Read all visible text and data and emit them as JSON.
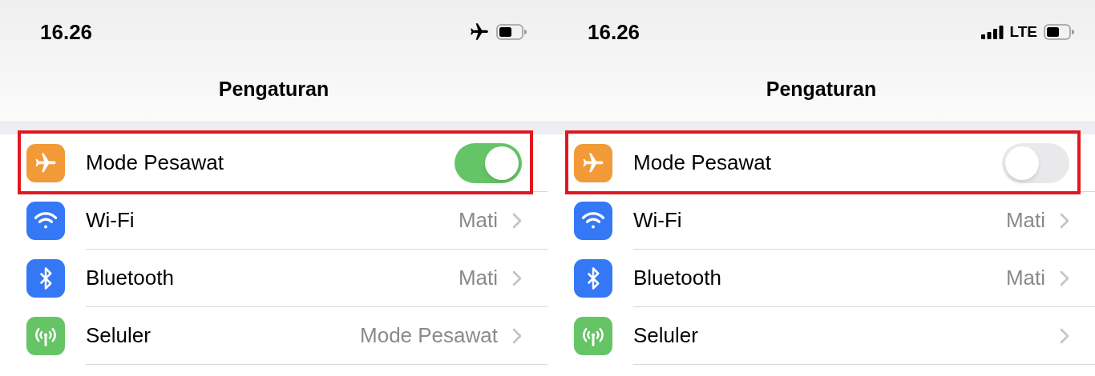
{
  "panels": [
    {
      "status_bar": {
        "time": "16.26",
        "icons": [
          {
            "kind": "airplane"
          },
          {
            "kind": "battery"
          }
        ]
      },
      "title": "Pengaturan",
      "rows": [
        {
          "kind": "airplane",
          "color": "#f19a37",
          "label": "Mode Pesawat",
          "on": true,
          "highlighted": true
        },
        {
          "kind": "wifi",
          "color": "#3478f6",
          "label": "Wi-Fi",
          "value": "Mati",
          "highlighted": false
        },
        {
          "kind": "bluetooth",
          "color": "#3478f6",
          "label": "Bluetooth",
          "value": "Mati",
          "highlighted": false
        },
        {
          "kind": "cellular",
          "color": "#65c466",
          "label": "Seluler",
          "value": "Mode Pesawat",
          "highlighted": false
        }
      ]
    },
    {
      "status_bar": {
        "time": "16.26",
        "icons": [
          {
            "kind": "signal"
          },
          {
            "kind": "text",
            "text": "LTE"
          },
          {
            "kind": "battery"
          }
        ]
      },
      "title": "Pengaturan",
      "rows": [
        {
          "kind": "airplane",
          "color": "#f19a37",
          "label": "Mode Pesawat",
          "on": false,
          "highlighted": true
        },
        {
          "kind": "wifi",
          "color": "#3478f6",
          "label": "Wi-Fi",
          "value": "Mati",
          "highlighted": false
        },
        {
          "kind": "bluetooth",
          "color": "#3478f6",
          "label": "Bluetooth",
          "value": "Mati",
          "highlighted": false
        },
        {
          "kind": "cellular",
          "color": "#65c466",
          "label": "Seluler",
          "highlighted": false
        }
      ]
    }
  ]
}
